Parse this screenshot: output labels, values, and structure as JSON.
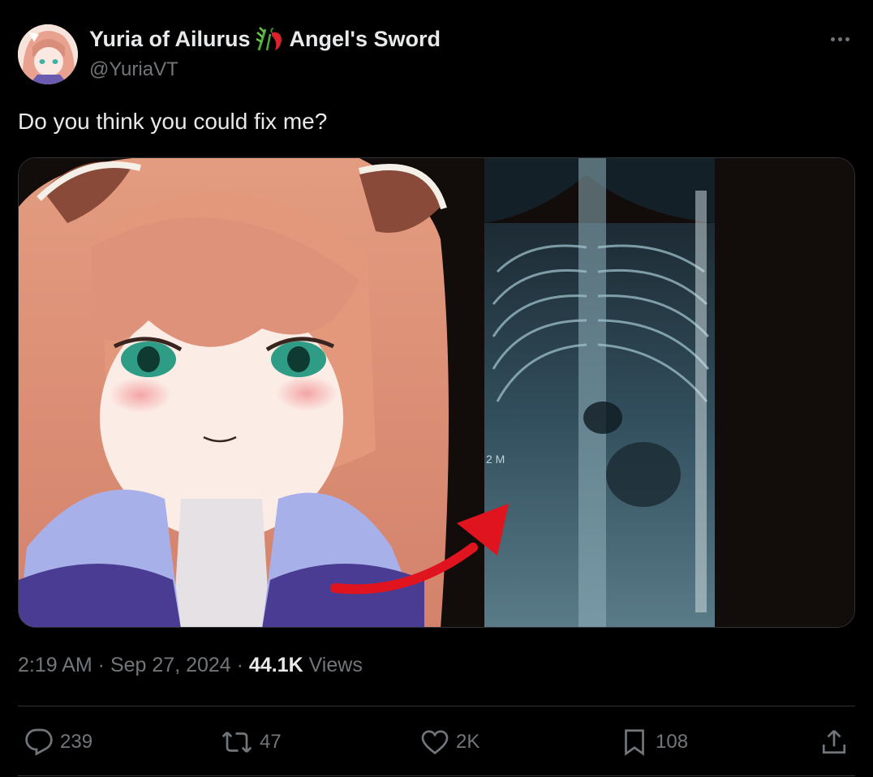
{
  "author": {
    "display_name": "Yuria of Ailurus",
    "display_name_suffix": "Angel's Sword",
    "handle": "@YuriaVT",
    "emoji": "bamboo-and-chili-emoji"
  },
  "tweet": {
    "text": "Do you think you could fix me?"
  },
  "media": {
    "xray_label": "2 M"
  },
  "meta": {
    "time": "2:19 AM",
    "separator1": " · ",
    "date": "Sep 27, 2024",
    "separator2": " · ",
    "views_count": "44.1K",
    "views_label": " Views"
  },
  "actions": {
    "reply_count": "239",
    "repost_count": "47",
    "like_count": "2K",
    "bookmark_count": "108"
  },
  "colors": {
    "background": "#000000",
    "text_primary": "#e7e9ea",
    "text_secondary": "#71767b",
    "divider": "#2f3336",
    "arrow": "#e0141e"
  },
  "icons": {
    "more": "more-horizontal-icon",
    "reply": "reply-icon",
    "repost": "repost-icon",
    "like": "heart-icon",
    "bookmark": "bookmark-icon",
    "share": "share-icon"
  }
}
